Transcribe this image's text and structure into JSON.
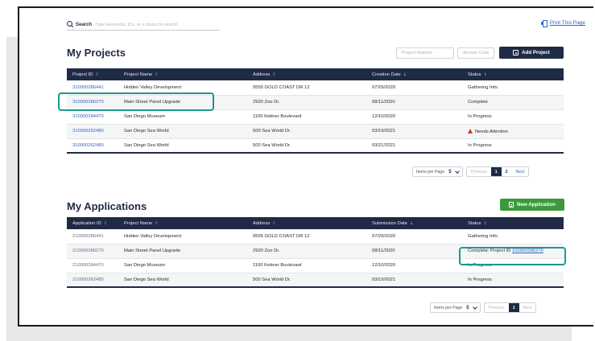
{
  "search": {
    "label": "Search",
    "placeholder": "Type keywords, IDs, or a status to search"
  },
  "print_label": "Print This Page",
  "projects": {
    "title": "My Projects",
    "project_number_placeholder": "Project Number",
    "access_code_placeholder": "Access Code",
    "add_button": "Add Project",
    "columns": [
      "Project ID",
      "Project Name",
      "Address",
      "Creation Date",
      "Status"
    ],
    "rows": [
      [
        "310000286441",
        "Hidden Valley Development",
        "9555 GOLD COAST DR 12",
        "07/29/2020",
        "Gathering Info."
      ],
      [
        "310000286270",
        "Main Street Panel Upgrade",
        "2920 Zoo Dr.",
        "08/11/2020",
        "Complete"
      ],
      [
        "310000284470",
        "San Diego Museum",
        "1100 Kettner Boulevard",
        "12/10/2020",
        "In Progress"
      ],
      [
        "310000262480",
        "San Diego Sea World",
        "500 Sea World Dr.",
        "03/19/2021",
        "Needs Attention"
      ],
      [
        "310000262480",
        "San Diego Sea World",
        "500 Sea World Dr.",
        "03/21/2021",
        "In Progress"
      ]
    ],
    "pager": {
      "items_label": "Items per Page",
      "per_page": "5",
      "prev": "Previous",
      "pages": [
        "1",
        "2"
      ],
      "next": "Next"
    }
  },
  "applications": {
    "title": "My Applications",
    "new_button": "New Application",
    "columns": [
      "Application ID",
      "Project Name",
      "Address",
      "Submission Date",
      "Status"
    ],
    "rows": [
      [
        "210000286441",
        "Hidden Valley Development",
        "9555 GOLD COAST DR 12",
        "07/29/2020",
        "Gathering Info."
      ],
      [
        "210000286270",
        "Main Street Panel Upgrade",
        "2920 Zoo Dr.",
        "08/11/2020",
        "Complete: Project ID "
      ],
      [
        "210000284470",
        "San Diego Museum",
        "1100 Kettner Boulevard",
        "12/10/2020",
        "In Progress"
      ],
      [
        "210000262480",
        "San Diego Sea World",
        "500 Sea World Dr.",
        "03/19/2021",
        "In Progress"
      ]
    ],
    "status_link": "310000286270",
    "pager": {
      "items_label": "Items per Page",
      "per_page": "5",
      "prev": "Previous",
      "pages": [
        "1"
      ],
      "next": "Next"
    }
  },
  "colors": {
    "navy": "#1f2a44",
    "link": "#2f66c6",
    "green": "#3a9a3c",
    "highlight": "#1a9a8a",
    "warning": "#d9342b"
  }
}
